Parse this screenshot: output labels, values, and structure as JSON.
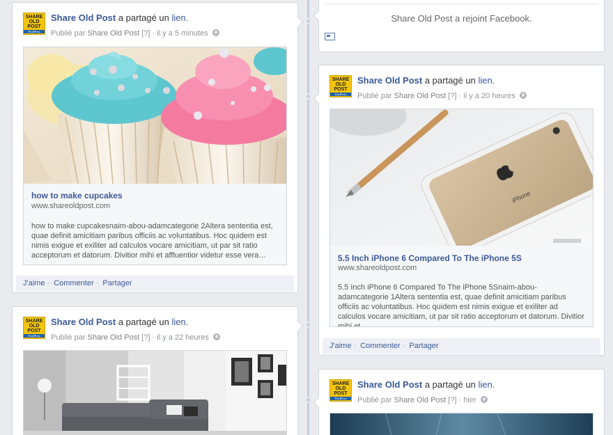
{
  "posts": [
    {
      "page_name": "Share Old Post",
      "action_text": "a partagé un",
      "link_word": "lien.",
      "published_by": "Publié par",
      "author": "Share Old Post",
      "help": "[?]",
      "time": "il y a 5 minutes",
      "preview_title": "how to make cupcakes",
      "preview_domain": "www.shareoldpost.com",
      "preview_desc": "how to make cupcakesnaim-abou-adamcategorie 2Altera sententia est, quae definit amicitiam paribus officiis ac voluntatibus. Hoc quidem est nimis exigue et exiliter ad calculos vocare amicitiam, ut par sit ratio acceptorum et datorum. Divitior mihi et affluentior videtur esse vera…",
      "image": "cupcakes-photo"
    },
    {
      "page_name": "Share Old Post",
      "action_text": "a partagé un",
      "link_word": "lien.",
      "published_by": "Publié par",
      "author": "Share Old Post",
      "help": "[?]",
      "time": "il y a 20 heures",
      "preview_title": "5.5 Inch iPhone 6 Compared To The iPhone 5S",
      "preview_domain": "www.shareoldpost.com",
      "preview_desc": "5.5 Inch iPhone 6 Compared To The iPhone 5Snaim-abou-adamcategorie 1Altera sententia est, quae definit amicitiam paribus officiis ac voluntatibus. Hoc quidem est nimis exigue et exiliter ad calculos vocare amicitiam, ut par sit ratio acceptorum et datorum. Divitior mihi et…",
      "image": "iphone-photo"
    },
    {
      "page_name": "Share Old Post",
      "action_text": "a partagé un",
      "link_word": "lien.",
      "published_by": "Publié par",
      "author": "Share Old Post",
      "help": "[?]",
      "time": "il y a 22 heures",
      "image": "living-room-photo"
    },
    {
      "page_name": "Share Old Post",
      "action_text": "a partagé un",
      "link_word": "lien.",
      "published_by": "Publié par",
      "author": "Share Old Post",
      "help": "[?]",
      "time": "hier",
      "image": "blue-texture-photo"
    }
  ],
  "joined_text": "Share Old Post a rejoint Facebook.",
  "actions": {
    "like": "J'aime",
    "comment": "Commenter",
    "share": "Partager"
  },
  "avatar": {
    "line1": "SHARE",
    "line2": "OLD",
    "line3": "POST",
    "brand": "WordPress"
  },
  "colors": {
    "link": "#3b5998",
    "avatar_bg": "#f2c40d",
    "avatar_band": "#1f5fa8",
    "timeline": "#c5cde0"
  }
}
